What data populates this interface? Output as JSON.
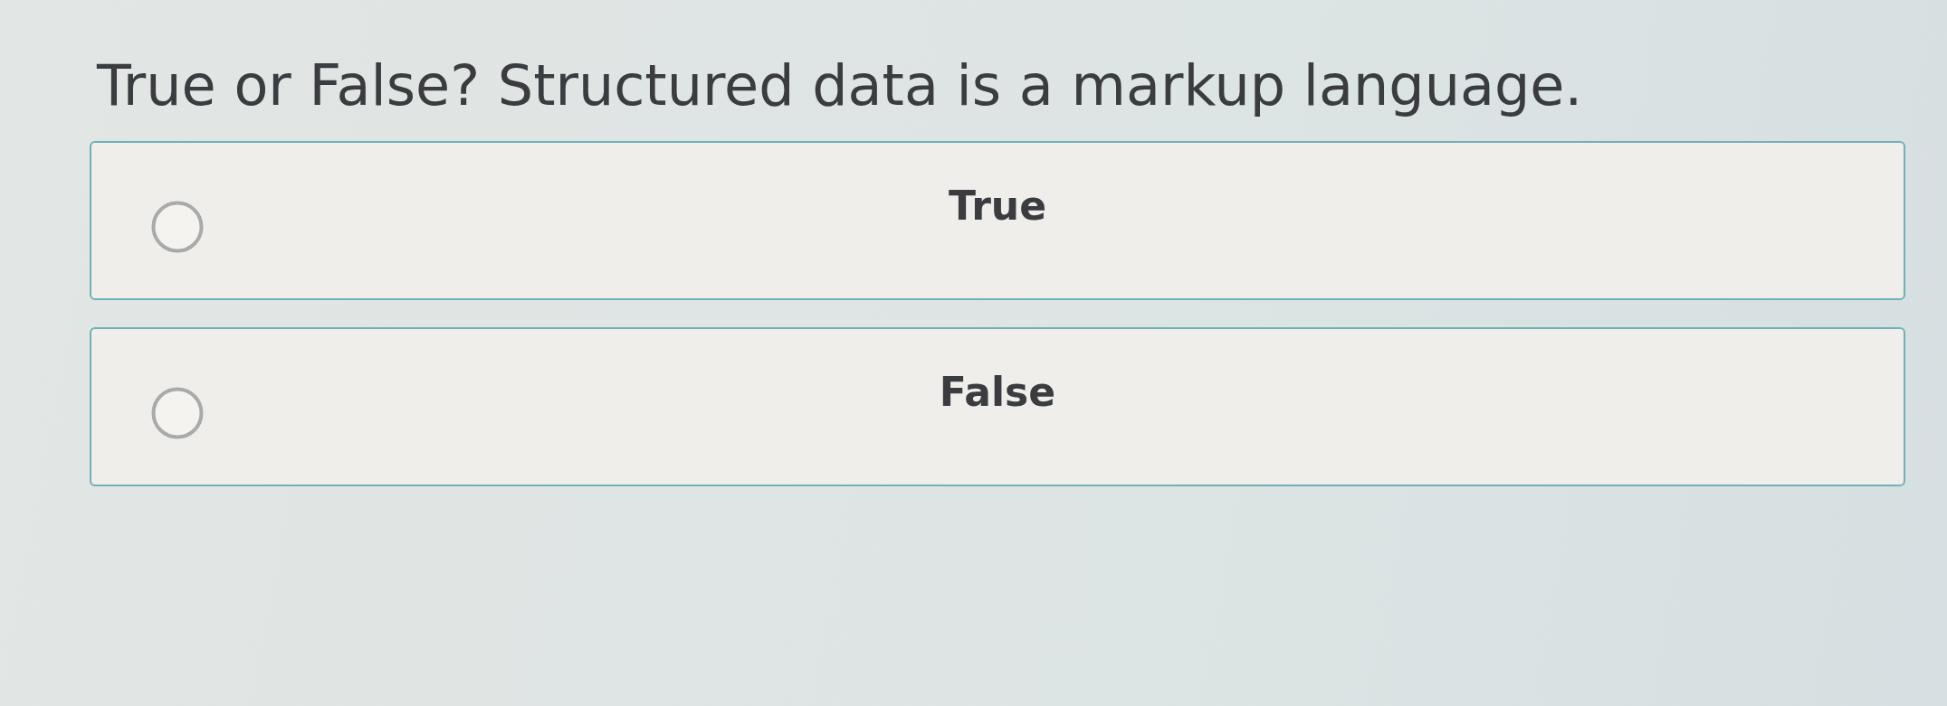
{
  "question": "True or False? Structured data is a markup language.",
  "options": [
    {
      "label": "True",
      "selected": false
    },
    {
      "label": "False",
      "selected": false
    }
  ]
}
